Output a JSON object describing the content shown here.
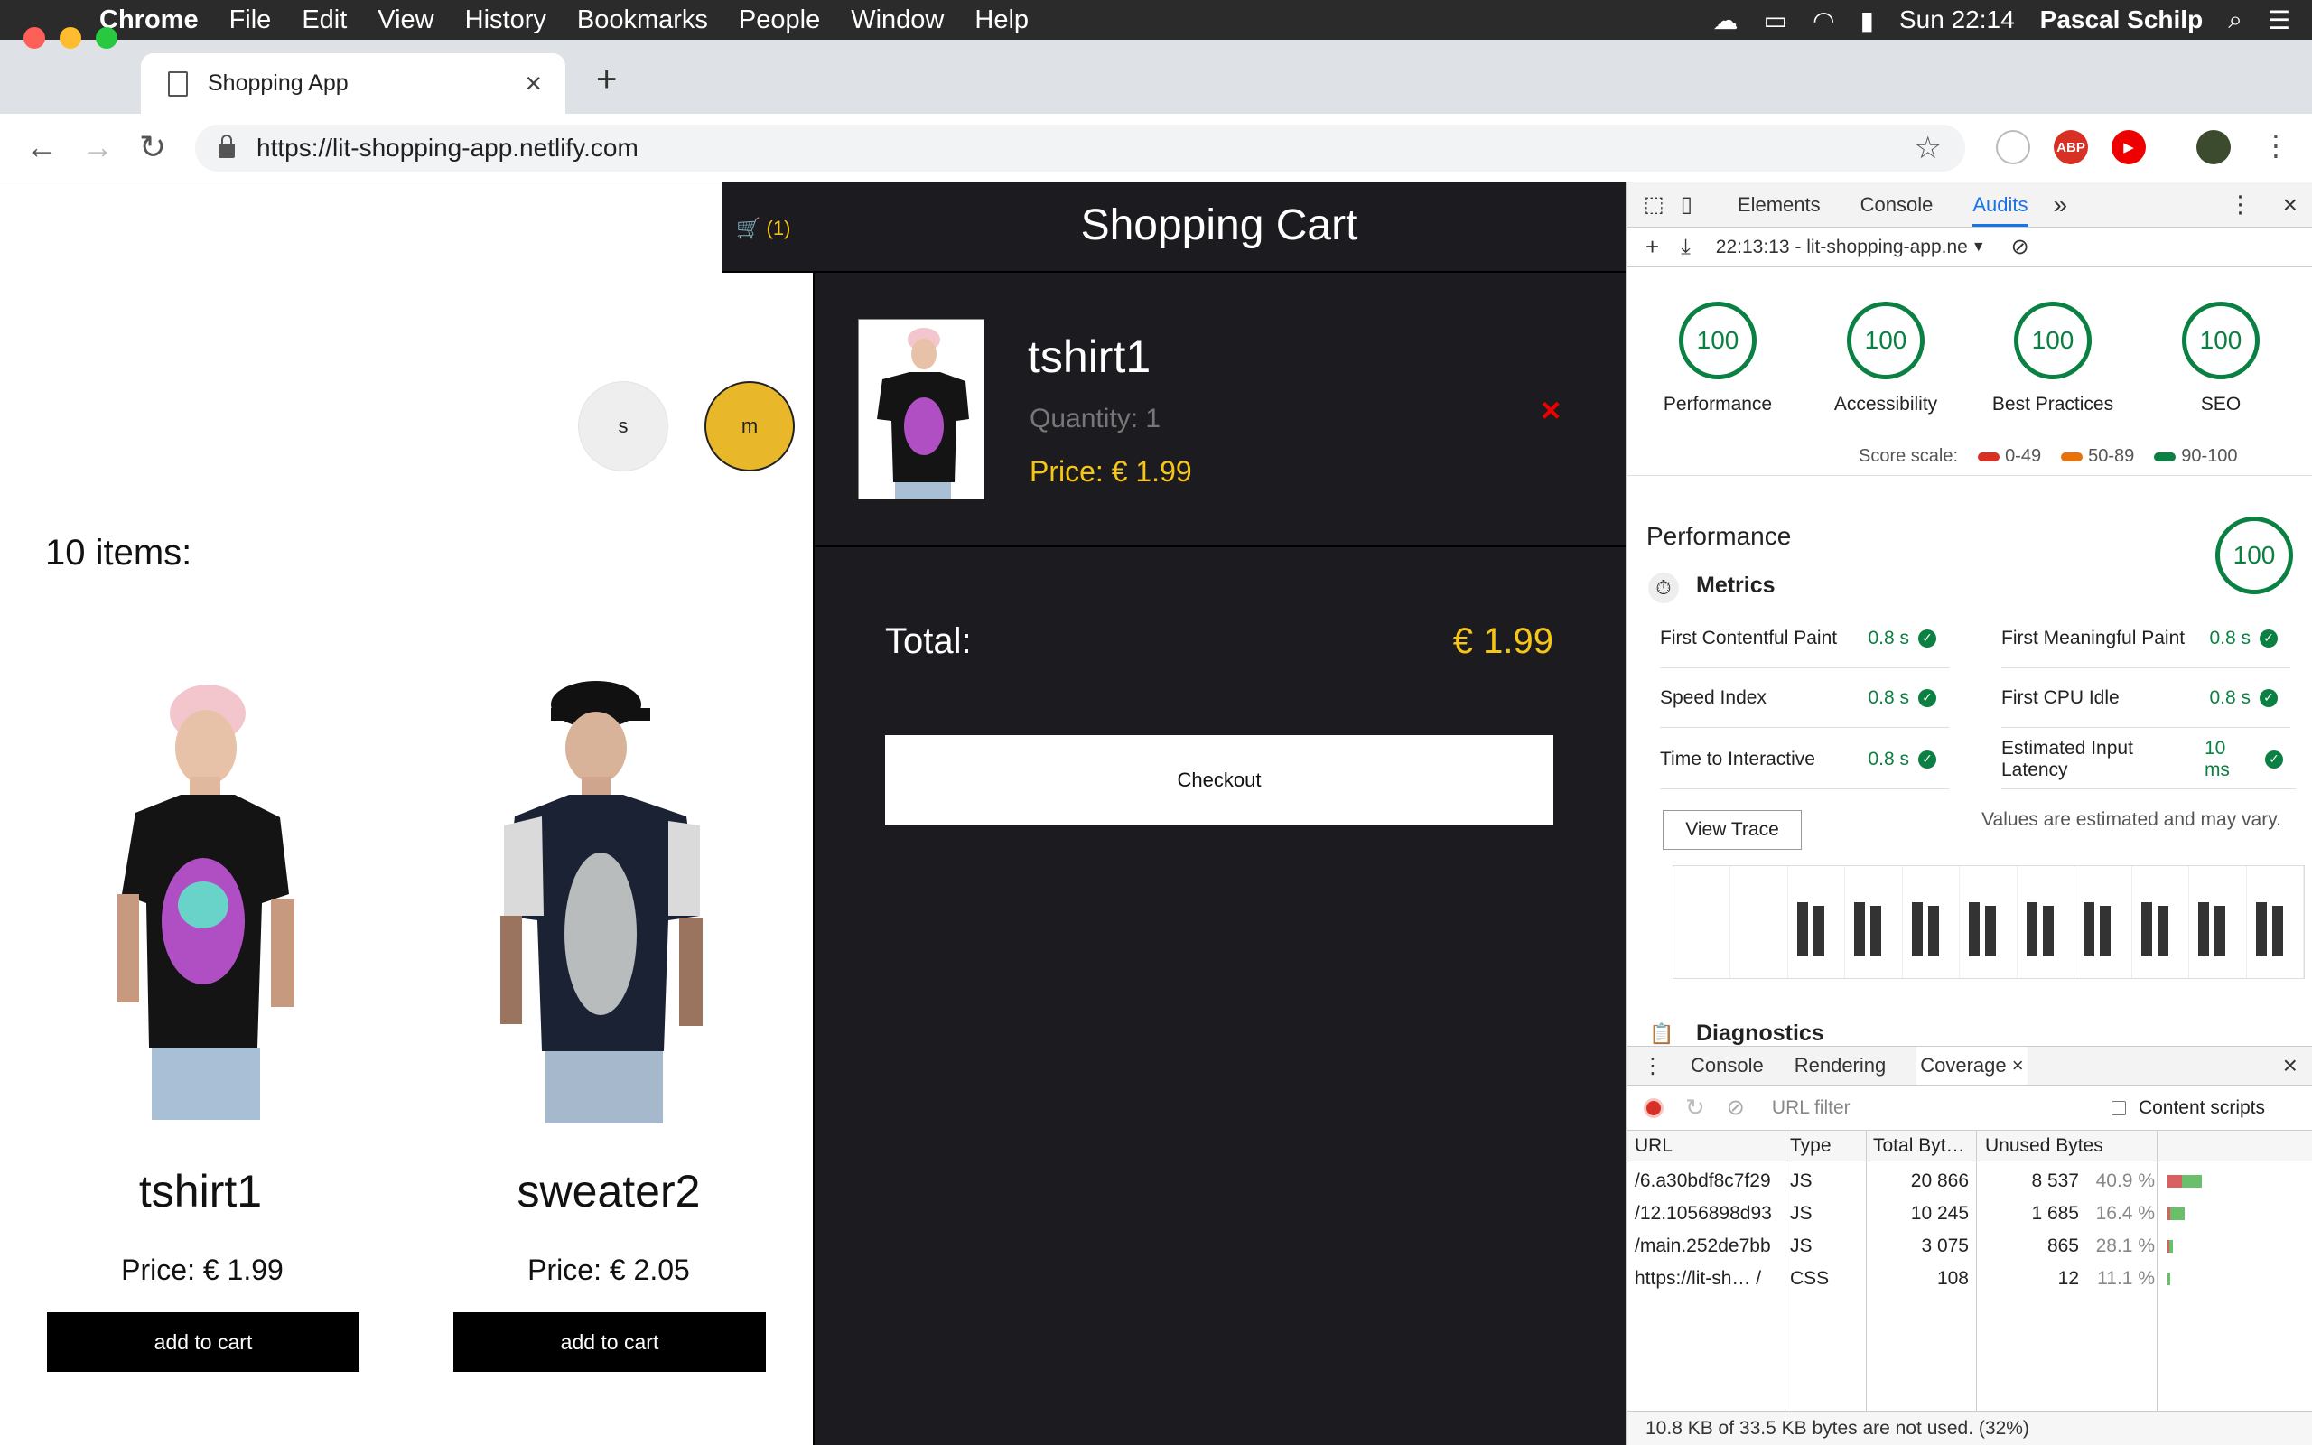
{
  "menubar": {
    "app": "Chrome",
    "items": [
      "File",
      "Edit",
      "View",
      "History",
      "Bookmarks",
      "People",
      "Window",
      "Help"
    ],
    "clock": "Sun 22:14",
    "user": "Pascal Schilp"
  },
  "browser": {
    "tab_title": "Shopping App",
    "url": "https://lit-shopping-app.netlify.com",
    "abp_label": "ABP"
  },
  "shop": {
    "sizes": [
      "s",
      "m"
    ],
    "selected_size": "m",
    "items_title": "10 items:",
    "products": [
      {
        "name": "tshirt1",
        "price": "Price: € 1.99",
        "button": "add to cart"
      },
      {
        "name": "sweater2",
        "price": "Price: € 2.05",
        "button": "add to cart"
      }
    ]
  },
  "cart": {
    "title": "Shopping Cart",
    "badge": "(1)",
    "item": {
      "name": "tshirt1",
      "quantity": "Quantity: 1",
      "price": "Price: € 1.99",
      "remove": "×"
    },
    "total_label": "Total:",
    "total_value": "€ 1.99",
    "checkout": "Checkout"
  },
  "devtools": {
    "tabs": [
      "Elements",
      "Console",
      "Audits"
    ],
    "active_tab": "Audits",
    "more": "»",
    "report": "22:13:13 - lit-shopping-app.ne",
    "scores": [
      {
        "label": "Performance",
        "value": "100"
      },
      {
        "label": "Accessibility",
        "value": "100"
      },
      {
        "label": "Best Practices",
        "value": "100"
      },
      {
        "label": "SEO",
        "value": "100"
      }
    ],
    "scale_label": "Score scale:",
    "scale": [
      {
        "range": "0-49",
        "color": "#d93025"
      },
      {
        "range": "50-89",
        "color": "#e8710a"
      },
      {
        "range": "90-100",
        "color": "#0b8043"
      }
    ],
    "performance_title": "Performance",
    "performance_score": "100",
    "metrics_title": "Metrics",
    "metrics": [
      {
        "name": "First Contentful Paint",
        "value": "0.8 s"
      },
      {
        "name": "First Meaningful Paint",
        "value": "0.8 s"
      },
      {
        "name": "Speed Index",
        "value": "0.8 s"
      },
      {
        "name": "First CPU Idle",
        "value": "0.8 s"
      },
      {
        "name": "Time to Interactive",
        "value": "0.8 s"
      },
      {
        "name": "Estimated Input Latency",
        "value": "10 ms"
      }
    ],
    "view_trace": "View Trace",
    "estimated_note": "Values are estimated and may vary.",
    "diagnostics": "Diagnostics"
  },
  "drawer": {
    "tabs": [
      "Console",
      "Rendering",
      "Coverage"
    ],
    "active_tab": "Coverage",
    "url_filter_placeholder": "URL filter",
    "content_scripts": "Content scripts",
    "columns": [
      "URL",
      "Type",
      "Total Byt…",
      "Unused Bytes"
    ],
    "rows": [
      {
        "url": "/6.a30bdf8c7f29",
        "type": "JS",
        "total": "20 866",
        "unused": "8 537",
        "pct": "40.9 %",
        "used_fraction": 0.591
      },
      {
        "url": "/12.1056898d93",
        "type": "JS",
        "total": "10 245",
        "unused": "1 685",
        "pct": "16.4 %",
        "used_fraction": 0.836
      },
      {
        "url": "/main.252de7bb",
        "type": "JS",
        "total": "3 075",
        "unused": "865",
        "pct": "28.1 %",
        "used_fraction": 0.719
      },
      {
        "url": "https://lit-sh…  /",
        "type": "CSS",
        "total": "108",
        "unused": "12",
        "pct": "11.1 %",
        "used_fraction": 0.889
      }
    ],
    "footer": "10.8 KB of 33.5 KB bytes are not used. (32%)"
  }
}
